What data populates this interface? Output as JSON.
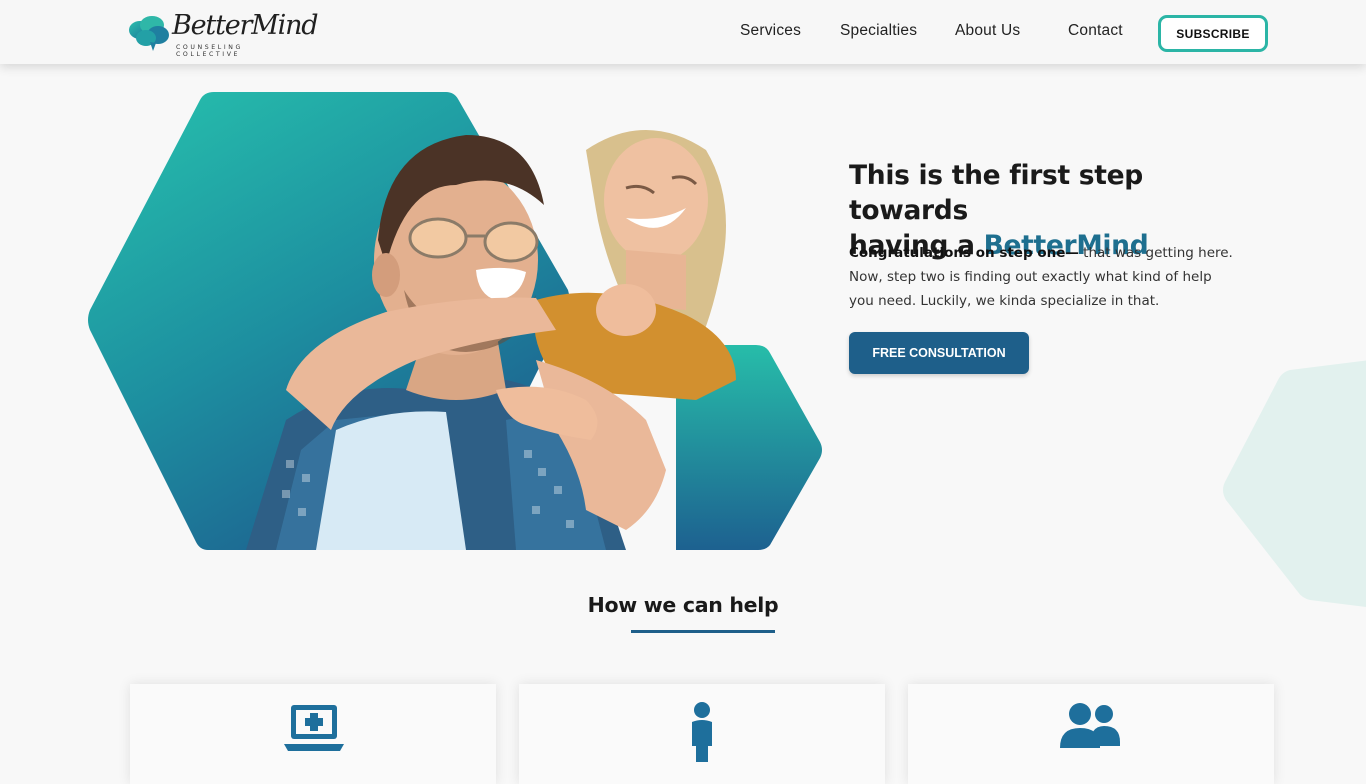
{
  "brand": {
    "name": "BetterMind",
    "tagline": "COUNSELING COLLECTIVE"
  },
  "nav": {
    "items": [
      {
        "label": "Services"
      },
      {
        "label": "Specialties"
      },
      {
        "label": "About Us"
      },
      {
        "label": "Contact"
      }
    ],
    "subscribe_label": "SUBSCRIBE"
  },
  "hero": {
    "title_line1": "This is the first step towards",
    "title_line2_prefix": "having a ",
    "title_brand": "BetterMind",
    "intro_bold": "Congratulations on step one—",
    "intro_rest": " that was getting here. Now, step two is finding out exactly what kind of help you need. Luckily, we kinda specialize in that.",
    "cta_label": "FREE CONSULTATION"
  },
  "help_section": {
    "title": "How we can help",
    "cards": [
      {
        "icon": "telehealth-laptop-icon"
      },
      {
        "icon": "individual-person-icon"
      },
      {
        "icon": "group-people-icon"
      }
    ]
  },
  "colors": {
    "accent_teal": "#2bb5a6",
    "brand_blue": "#1e5f8a",
    "brand_text": "#1e6f8f"
  }
}
